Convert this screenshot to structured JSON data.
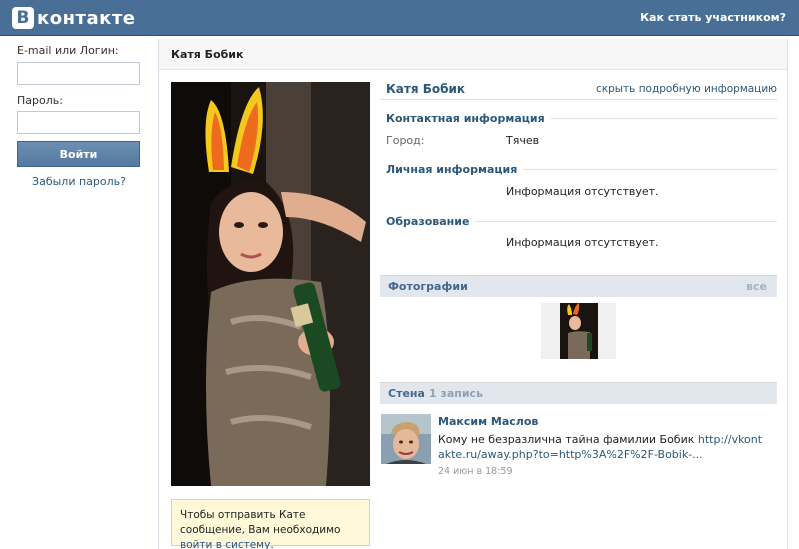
{
  "header": {
    "logo_letter": "B",
    "logo_text": "контакте",
    "join_link": "Как стать участником?"
  },
  "login": {
    "email_label": "E-mail или Логин:",
    "password_label": "Пароль:",
    "login_button": "Войти",
    "forgot_link": "Забыли пароль?"
  },
  "page": {
    "title": "Катя Бобик"
  },
  "notice": {
    "text": "Чтобы отправить Кате сообщение, Вам необходимо ",
    "link": "войти в систему",
    "end": "."
  },
  "profile": {
    "name": "Катя Бобик",
    "hide_link": "скрыть подробную информацию",
    "contact_title": "Контактная информация",
    "city_label": "Город:",
    "city_value": "Тячев",
    "personal_title": "Личная информация",
    "personal_empty": "Информация отсутствует.",
    "education_title": "Образование",
    "education_empty": "Информация отсутствует."
  },
  "photos": {
    "title": "Фотографии",
    "all_link": "все"
  },
  "wall": {
    "title": "Стена",
    "count": "1 запись",
    "post": {
      "author": "Максим Маслов",
      "text": "Кому не безразлична тайна фамилии Бобик ",
      "link": "http://vkontakte.ru/away.php?to=http%3A%2F%2F-Bobik-...",
      "date": "24 июн в 18:59"
    }
  },
  "colors": {
    "header_bg": "#4a6f96",
    "link": "#2b587a",
    "notice_bg": "#fff9d9"
  }
}
